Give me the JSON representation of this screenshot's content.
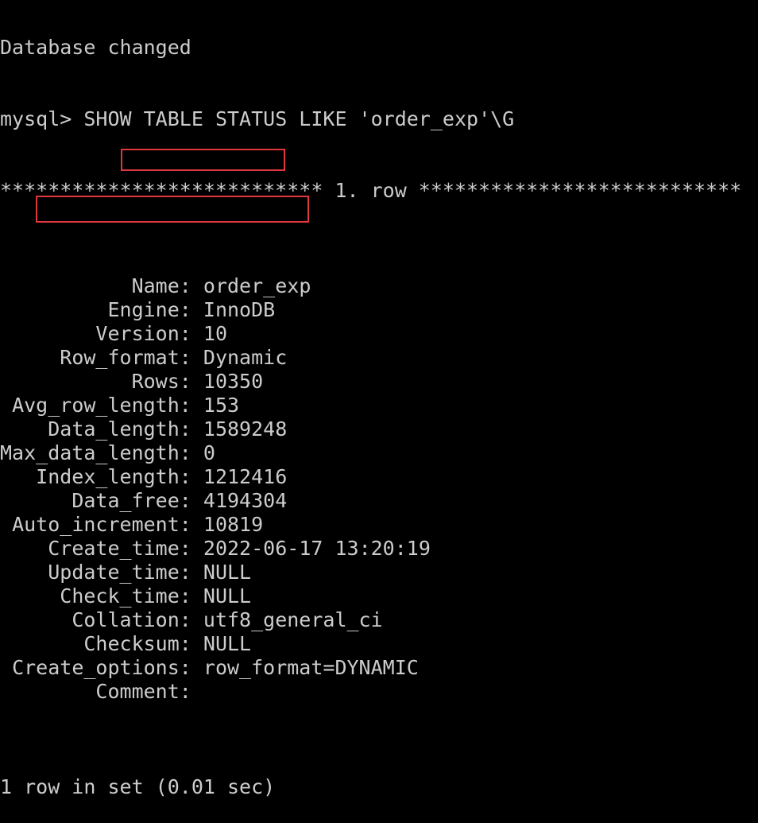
{
  "terminal": {
    "header_line": "Database changed",
    "prompt": "mysql>",
    "command": "SHOW TABLE STATUS LIKE 'order_exp'\\G",
    "separator": "*************************** 1. row ***************************",
    "rows": [
      {
        "field": "Name",
        "value": "order_exp"
      },
      {
        "field": "Engine",
        "value": "InnoDB"
      },
      {
        "field": "Version",
        "value": "10"
      },
      {
        "field": "Row_format",
        "value": "Dynamic"
      },
      {
        "field": "Rows",
        "value": "10350"
      },
      {
        "field": "Avg_row_length",
        "value": "153"
      },
      {
        "field": "Data_length",
        "value": "1589248"
      },
      {
        "field": "Max_data_length",
        "value": "0"
      },
      {
        "field": "Index_length",
        "value": "1212416"
      },
      {
        "field": "Data_free",
        "value": "4194304"
      },
      {
        "field": "Auto_increment",
        "value": "10819"
      },
      {
        "field": "Create_time",
        "value": "2022-06-17 13:20:19"
      },
      {
        "field": "Update_time",
        "value": "NULL"
      },
      {
        "field": "Check_time",
        "value": "NULL"
      },
      {
        "field": "Collation",
        "value": "utf8_general_ci"
      },
      {
        "field": "Checksum",
        "value": "NULL"
      },
      {
        "field": "Create_options",
        "value": "row_format=DYNAMIC"
      },
      {
        "field": "Comment",
        "value": ""
      }
    ],
    "footer": "1 row in set (0.01 sec)",
    "highlighted_fields": [
      "Rows",
      "Data_length"
    ]
  },
  "colors": {
    "background": "#000000",
    "text": "#cccccc",
    "highlight_border": "#e0383c"
  }
}
